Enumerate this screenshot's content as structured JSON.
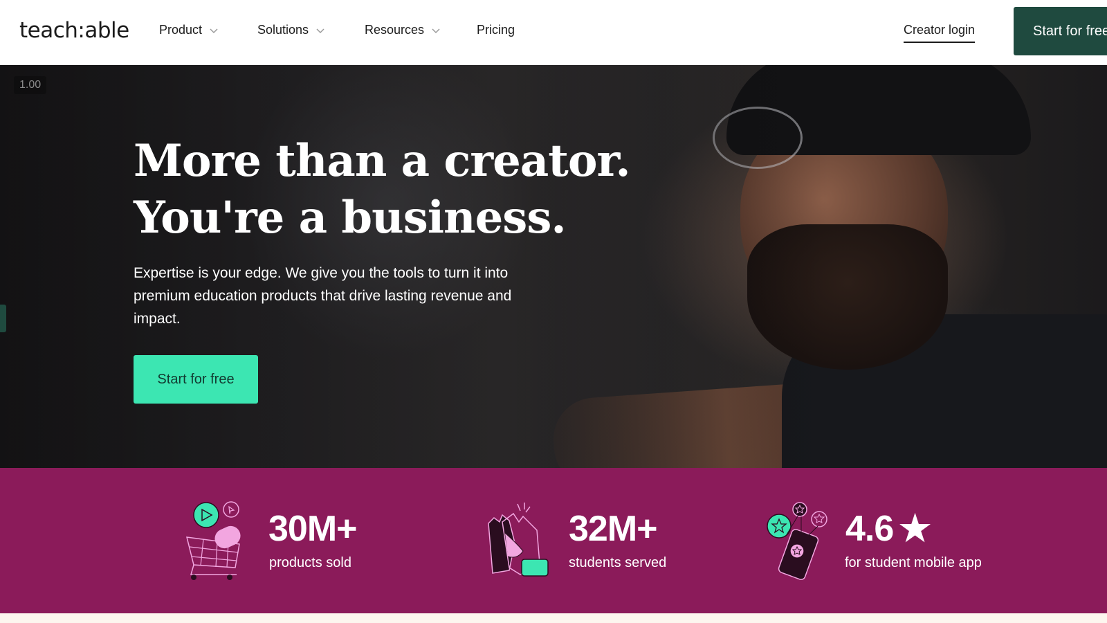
{
  "nav": {
    "logo": "teach:able",
    "items": [
      {
        "label": "Product",
        "dropdown": true
      },
      {
        "label": "Solutions",
        "dropdown": true
      },
      {
        "label": "Resources",
        "dropdown": true
      },
      {
        "label": "Pricing",
        "dropdown": false
      }
    ],
    "login_label": "Creator login",
    "cta_label": "Start for free"
  },
  "hero": {
    "zoom_label": "1.00",
    "headline_line1": "More than a creator.",
    "headline_line2": "You're a business.",
    "subcopy": "Expertise is your edge. We give you the tools to turn it into premium education products that drive lasting revenue and impact.",
    "cta_label": "Start for free"
  },
  "stats": [
    {
      "icon": "shopping-cart-icon",
      "value": "30M+",
      "label": "products sold"
    },
    {
      "icon": "high-five-icon",
      "value": "32M+",
      "label": "students served"
    },
    {
      "icon": "mobile-app-rating-icon",
      "value": "4.6",
      "suffix_icon": "star-icon",
      "label": "for student mobile app"
    }
  ],
  "colors": {
    "brand_dark_green": "#1f4a3f",
    "brand_mint": "#3ce6b2",
    "stats_magenta": "#8b1b5a",
    "pink_accent": "#f2a6e0",
    "cream": "#fdf6ef"
  }
}
